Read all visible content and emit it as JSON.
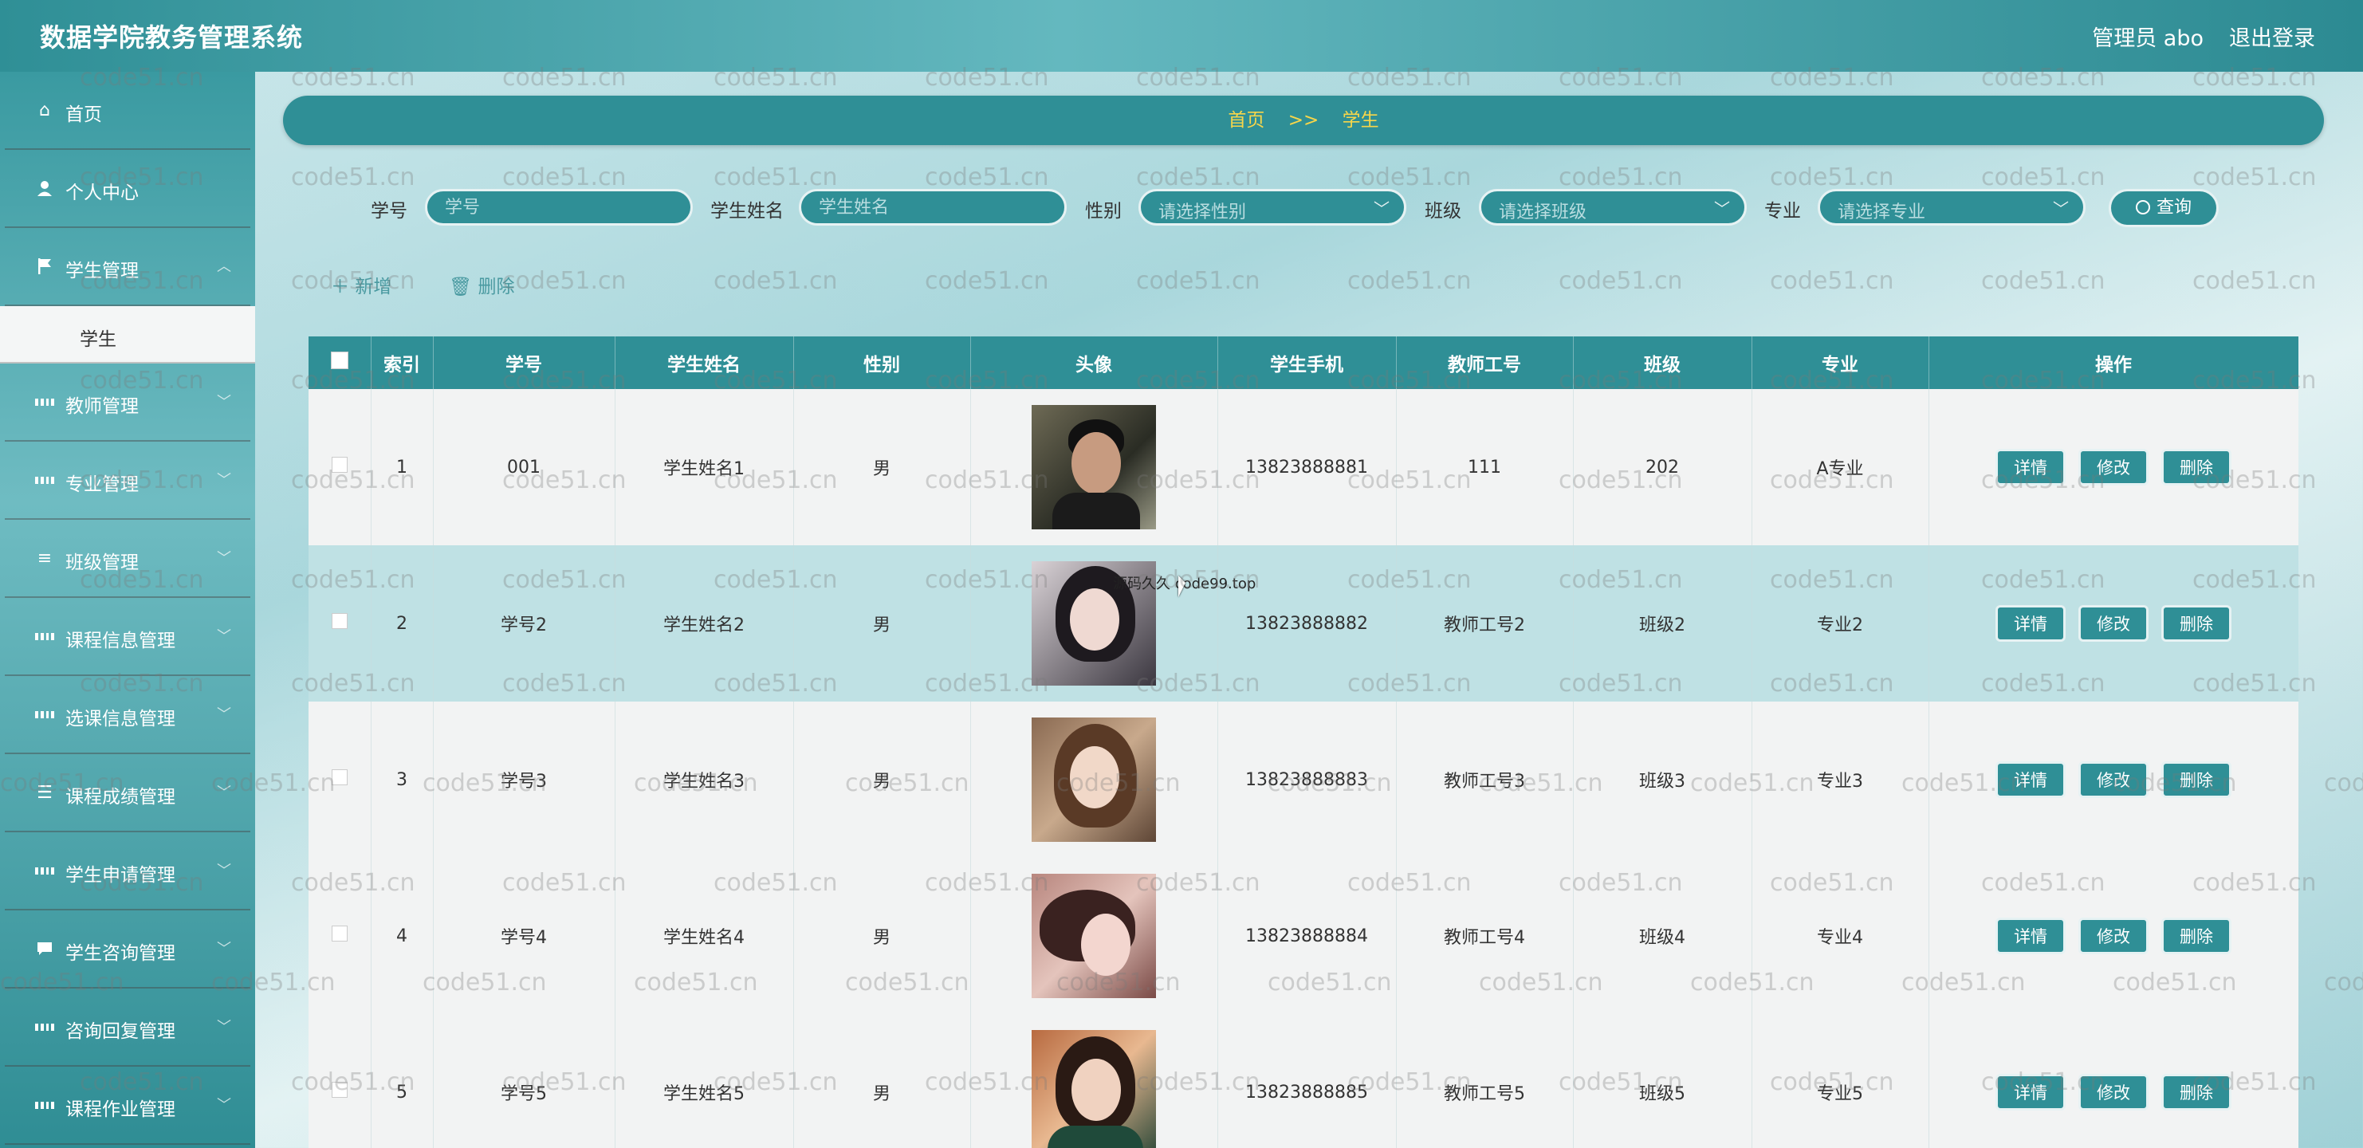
{
  "header": {
    "title": "数据学院教务管理系统",
    "user": "管理员 abo",
    "logout": "退出登录"
  },
  "sidebar": {
    "items": [
      {
        "label": "首页",
        "icon": "home-icon"
      },
      {
        "label": "个人中心",
        "icon": "user-icon"
      },
      {
        "label": "学生管理",
        "icon": "flag-icon",
        "expanded": true,
        "sub": "学生"
      },
      {
        "label": "教师管理",
        "icon": "grid-icon"
      },
      {
        "label": "专业管理",
        "icon": "grid-icon"
      },
      {
        "label": "班级管理",
        "icon": "menu-icon"
      },
      {
        "label": "课程信息管理",
        "icon": "grid-icon"
      },
      {
        "label": "选课信息管理",
        "icon": "grid-icon"
      },
      {
        "label": "课程成绩管理",
        "icon": "list-icon"
      },
      {
        "label": "学生申请管理",
        "icon": "grid-icon"
      },
      {
        "label": "学生咨询管理",
        "icon": "chat-icon"
      },
      {
        "label": "咨询回复管理",
        "icon": "grid-icon"
      },
      {
        "label": "课程作业管理",
        "icon": "grid-icon"
      }
    ]
  },
  "breadcrumb": {
    "home": "首页",
    "sep": ">>",
    "current": "学生"
  },
  "search": {
    "xuehao_label": "学号",
    "xuehao_placeholder": "学号",
    "name_label": "学生姓名",
    "name_placeholder": "学生姓名",
    "gender_label": "性别",
    "gender_placeholder": "请选择性别",
    "class_label": "班级",
    "class_placeholder": "请选择班级",
    "major_label": "专业",
    "major_placeholder": "请选择专业",
    "query": "查询"
  },
  "actions": {
    "add": "新增",
    "delete": "删除"
  },
  "table": {
    "headers": [
      "索引",
      "学号",
      "学生姓名",
      "性别",
      "头像",
      "学生手机",
      "教师工号",
      "班级",
      "专业",
      "操作"
    ],
    "rows": [
      {
        "index": "1",
        "id": "001",
        "name": "学生姓名1",
        "gender": "男",
        "phone": "13823888881",
        "teacher": "111",
        "class": "202",
        "major": "A专业"
      },
      {
        "index": "2",
        "id": "学号2",
        "name": "学生姓名2",
        "gender": "男",
        "phone": "13823888882",
        "teacher": "教师工号2",
        "class": "班级2",
        "major": "专业2"
      },
      {
        "index": "3",
        "id": "学号3",
        "name": "学生姓名3",
        "gender": "男",
        "phone": "13823888883",
        "teacher": "教师工号3",
        "class": "班级3",
        "major": "专业3"
      },
      {
        "index": "4",
        "id": "学号4",
        "name": "学生姓名4",
        "gender": "男",
        "phone": "13823888884",
        "teacher": "教师工号4",
        "class": "班级4",
        "major": "专业4"
      },
      {
        "index": "5",
        "id": "学号5",
        "name": "学生姓名5",
        "gender": "男",
        "phone": "13823888885",
        "teacher": "教师工号5",
        "class": "班级5",
        "major": "专业5"
      }
    ],
    "ops": {
      "detail": "详情",
      "edit": "修改",
      "del": "删除"
    }
  },
  "watermark": "code51.cn",
  "overlay": "源码久久 code99.top",
  "colors": {
    "primary": "#2f8f96",
    "accent": "#f7d64a",
    "row_alt": "#bfe1e4"
  }
}
